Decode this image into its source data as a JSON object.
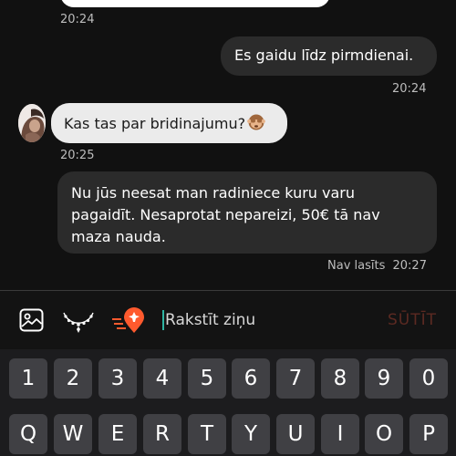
{
  "messages": {
    "time_1": "20:24",
    "outgoing_1": {
      "text": "Es gaidu līdz pirmdienai.",
      "time": "20:24"
    },
    "incoming_1": {
      "text": "Kas tas par bridinajumu?",
      "emoji": "see-no-evil-monkey-icon",
      "time": "20:25"
    },
    "outgoing_2": {
      "text": "Nu jūs neesat man radiniece kuru varu pagaidīt. Nesaprotat nepareizi, 50€ tā nav maza nauda.",
      "status": "Nav lasīts",
      "time": "20:27"
    }
  },
  "composer": {
    "input_placeholder": "Rakstīt ziņu",
    "send_label": "SŪTĪT",
    "icons": [
      "image-icon",
      "necklace-icon",
      "location-pin-icon"
    ],
    "accent_color": "#ff5a2e",
    "cursor_color": "#2fb5a2"
  },
  "keyboard": {
    "number_row": [
      "1",
      "2",
      "3",
      "4",
      "5",
      "6",
      "7",
      "8",
      "9",
      "0"
    ],
    "letter_row_1": [
      "Q",
      "W",
      "E",
      "R",
      "T",
      "Y",
      "U",
      "I",
      "O",
      "P"
    ]
  }
}
